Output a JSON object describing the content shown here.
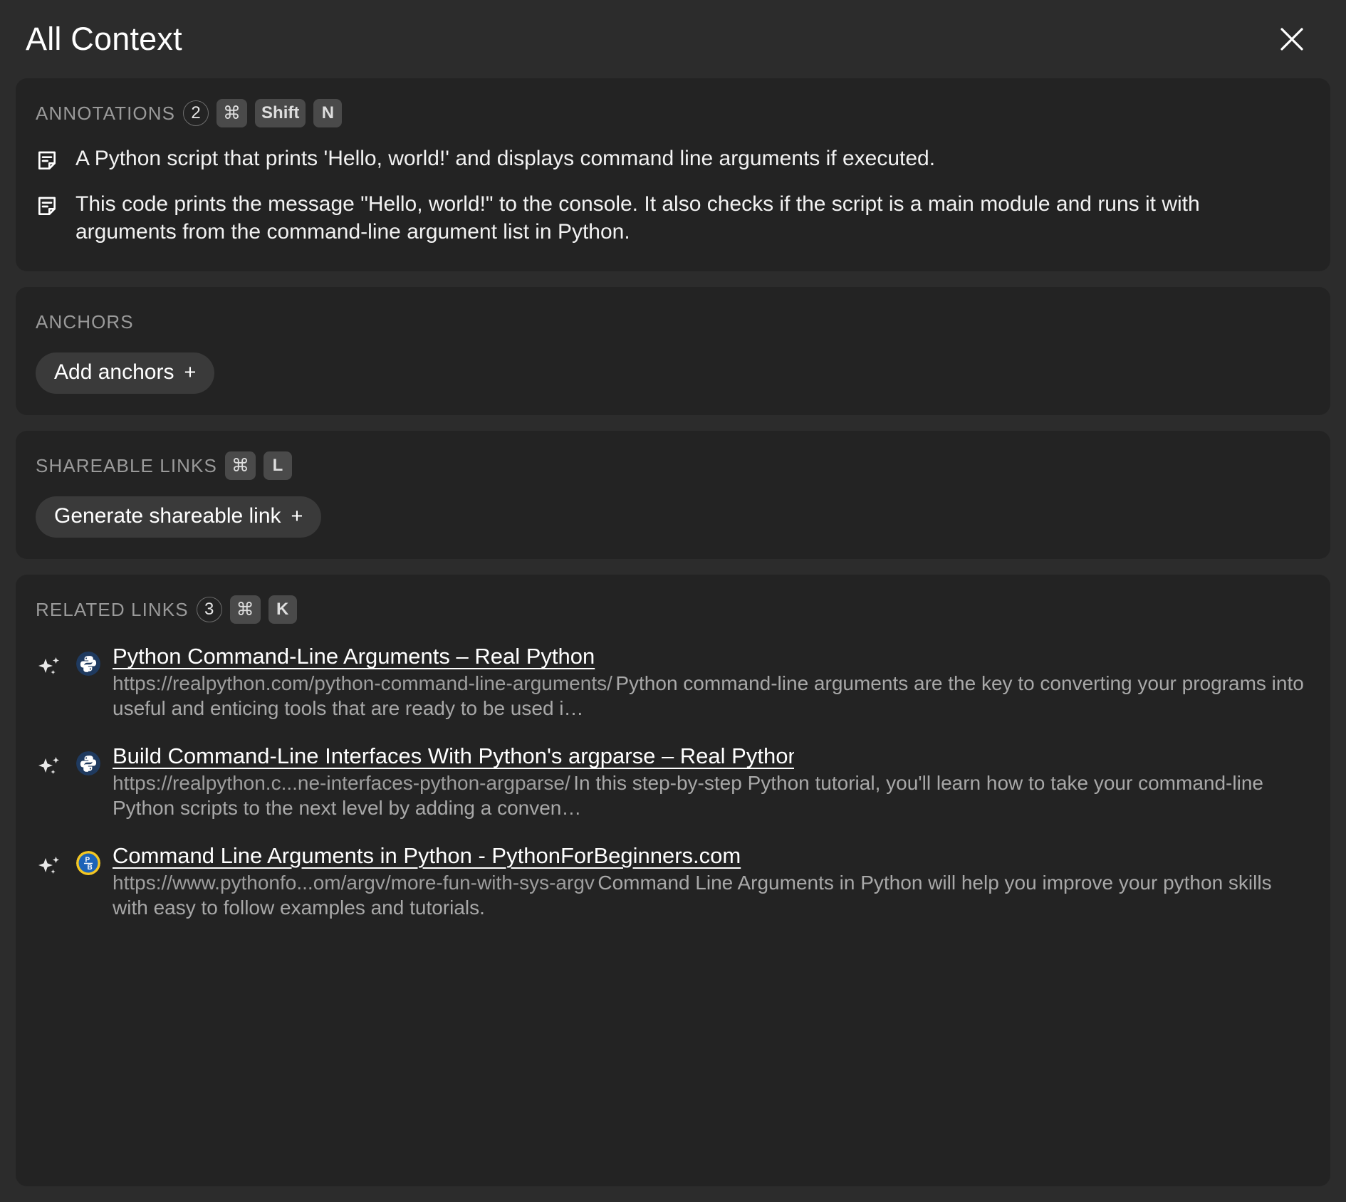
{
  "header": {
    "title": "All Context",
    "close_label": "×"
  },
  "annotations": {
    "label": "ANNOTATIONS",
    "count": "2",
    "shortcut": [
      "⌘",
      "Shift",
      "N"
    ],
    "items": [
      {
        "text": "A Python script that prints 'Hello, world!' and displays command line arguments if executed."
      },
      {
        "text": "This code prints the message \"Hello, world!\" to the console. It also checks if the script is a main module and runs it with arguments from the command-line argument list in Python."
      }
    ]
  },
  "anchors": {
    "label": "ANCHORS",
    "button_label": "Add anchors",
    "button_plus": "+"
  },
  "shareable_links": {
    "label": "SHAREABLE LINKS",
    "shortcut": [
      "⌘",
      "L"
    ],
    "button_label": "Generate shareable link",
    "button_plus": "+"
  },
  "related_links": {
    "label": "RELATED LINKS",
    "count": "3",
    "shortcut": [
      "⌘",
      "K"
    ],
    "items": [
      {
        "title": "Python Command-Line Arguments – Real Python",
        "url": "https://realpython.com/python-command-line-arguments/",
        "description": "Python command-line arguments are the key to converting your programs into useful and enticing tools that are ready to be used i…",
        "favicon": "python-logo-icon"
      },
      {
        "title": "Build Command-Line Interfaces With Python's argparse – Real Python",
        "url": "https://realpython.c...ne-interfaces-python-argparse/",
        "description": "In this step-by-step Python tutorial, you'll learn how to take your command-line Python scripts to the next level by adding a conven…",
        "favicon": "python-logo-icon"
      },
      {
        "title": "Command Line Arguments in Python - PythonForBeginners.com",
        "url": "https://www.pythonfo...om/argv/more-fun-with-sys-argv",
        "description": "Command Line Arguments in Python will help you improve your python skills with easy to follow examples and tutorials.",
        "favicon": "pythonforbeginners-logo-icon"
      }
    ]
  },
  "colors": {
    "background": "#2c2c2c",
    "card": "#232323",
    "pill": "#3a3a3a",
    "kbd": "#4a4a4a",
    "muted_text": "#9a9a9a",
    "body_text": "#f2f2f2"
  }
}
